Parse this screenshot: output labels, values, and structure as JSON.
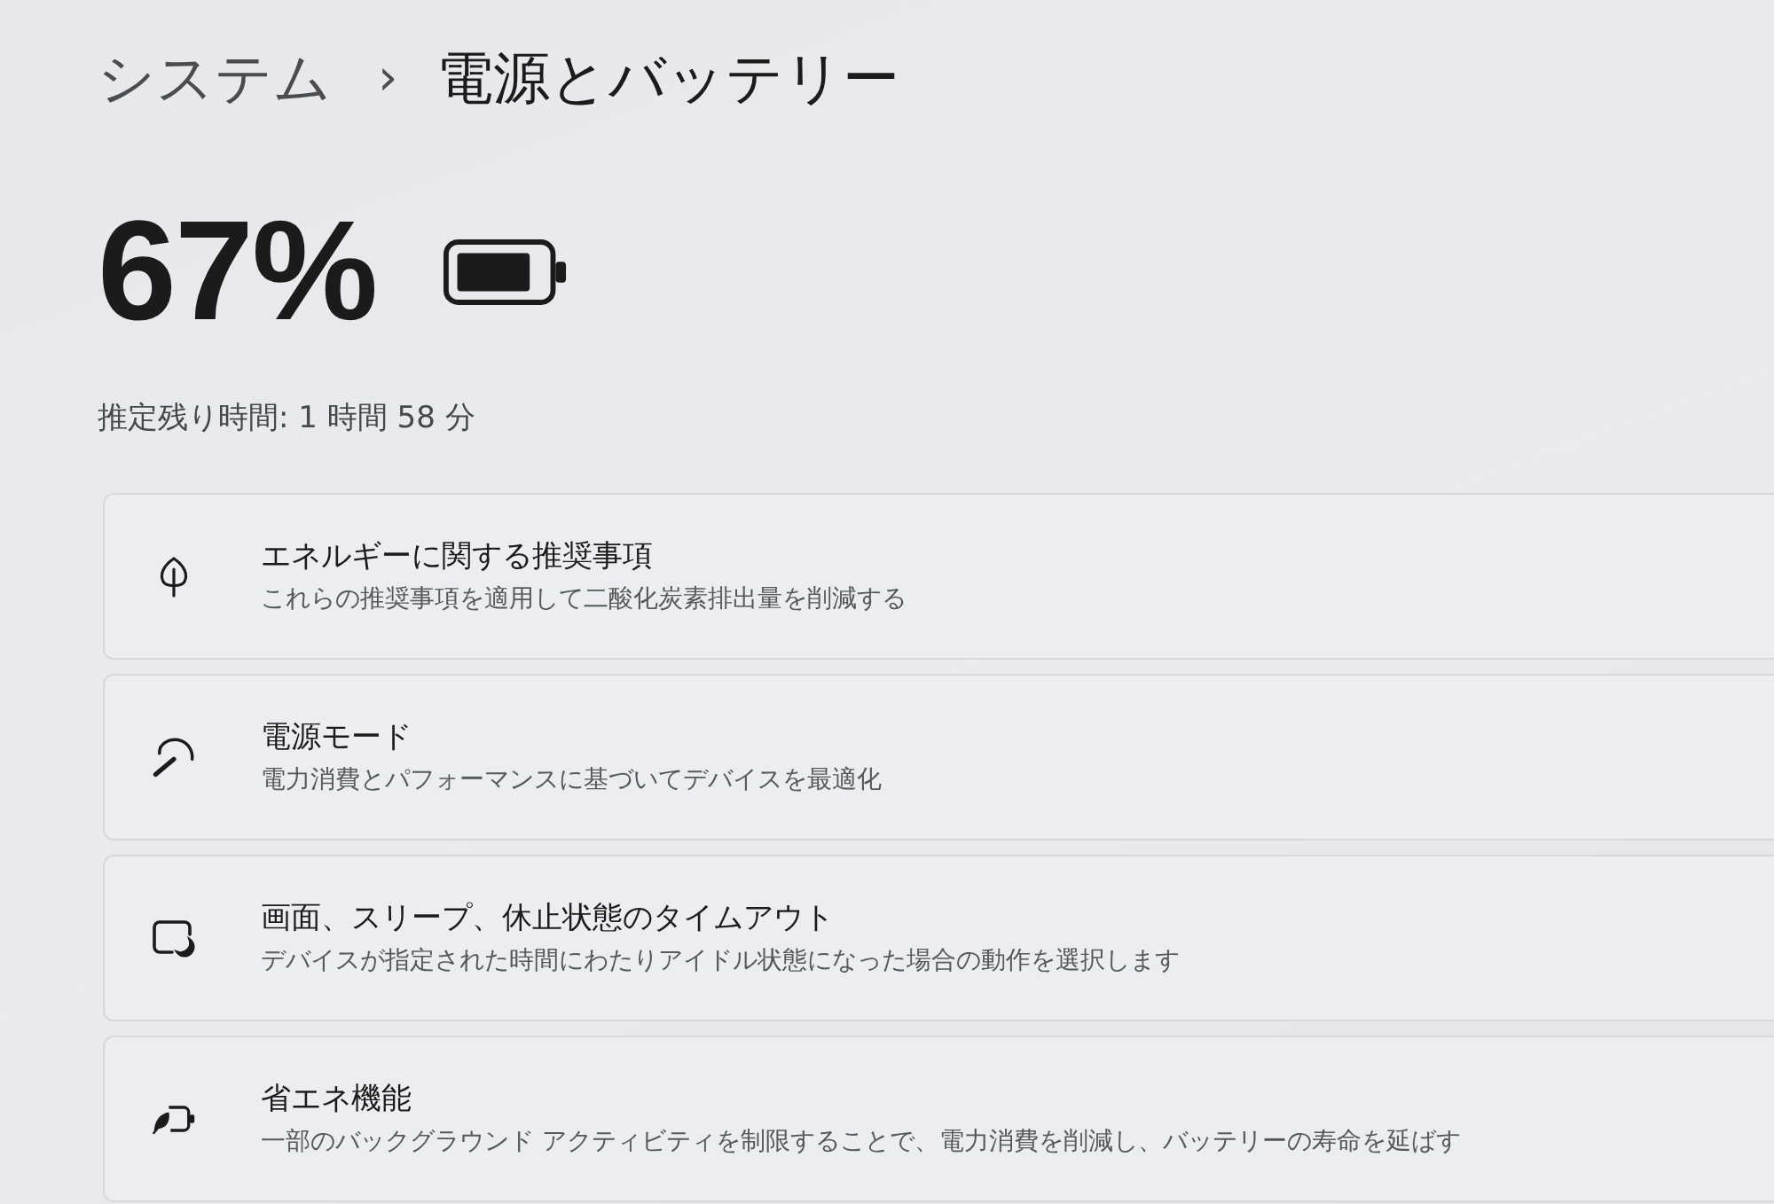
{
  "breadcrumb": {
    "parent": "システム",
    "separator": "›",
    "current": "電源とバッテリー"
  },
  "battery": {
    "percent": "67%",
    "estimate": "推定残り時間: 1 時間 58 分"
  },
  "settings": [
    {
      "kind": "energy",
      "title": "エネルギーに関する推奨事項",
      "description": "これらの推奨事項を適用して二酸化炭素排出量を削減する"
    },
    {
      "kind": "power",
      "title": "電源モード",
      "description": "電力消費とパフォーマンスに基づいてデバイスを最適化"
    },
    {
      "kind": "sleep",
      "title": "画面、スリープ、休止状態のタイムアウト",
      "description": "デバイスが指定された時間にわたりアイドル状態になった場合の動作を選択します"
    },
    {
      "kind": "saver",
      "title": "省エネ機能",
      "description": "一部のバックグラウンド アクティビティを制限することで、電力消費を削減し、バッテリーの寿命を延ばす"
    }
  ]
}
